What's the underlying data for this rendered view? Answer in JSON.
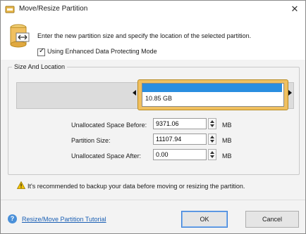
{
  "window": {
    "title": "Move/Resize Partition",
    "close_glyph": "✕"
  },
  "header": {
    "instruction": "Enter the new partition size and specify the location of the selected partition.",
    "data_protect": {
      "label": "Using Enhanced Data Protecting Mode",
      "checked": true,
      "tick": "✓"
    }
  },
  "size_location": {
    "group_title": "Size And Location",
    "partition_label": "10.85 GB",
    "fields": [
      {
        "label": "Unallocated Space Before:",
        "value": "9371.06",
        "unit": "MB"
      },
      {
        "label": "Partition Size:",
        "value": "11107.94",
        "unit": "MB"
      },
      {
        "label": "Unallocated Space After:",
        "value": "0.00",
        "unit": "MB"
      }
    ]
  },
  "warning": {
    "text": "It's recommended to backup your data before moving or resizing the partition."
  },
  "footer": {
    "tutorial_link": "Resize/Move Partition Tutorial",
    "help_glyph": "?",
    "ok_label": "OK",
    "cancel_label": "Cancel"
  },
  "colors": {
    "partition_fill": "#2a8ee0",
    "partition_frame": "#f0c060",
    "link": "#1a5fb4"
  },
  "icons": [
    "app-icon",
    "close-icon",
    "disk-resize-icon",
    "checkbox-tick-icon",
    "left-handle-icon",
    "right-handle-icon",
    "warning-icon",
    "help-icon"
  ]
}
